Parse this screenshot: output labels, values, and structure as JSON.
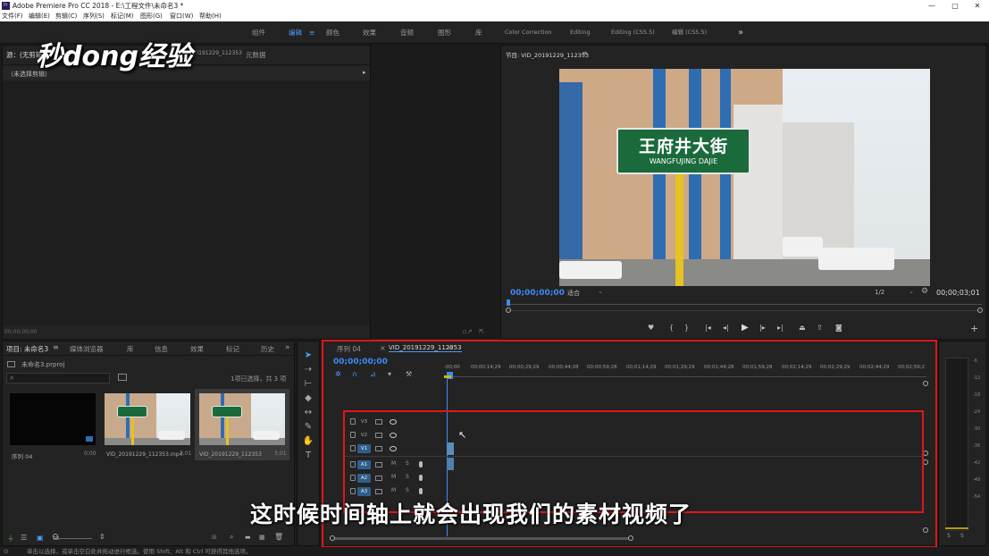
{
  "app": {
    "title": "Adobe Premiere Pro CC 2018 - E:\\工程文件\\未命名3 *",
    "logo": "Pr"
  },
  "window_controls": {
    "minimize": "—",
    "maximize": "▢",
    "close": "✕"
  },
  "menu": [
    "文件(F)",
    "编辑(E)",
    "剪辑(C)",
    "序列(S)",
    "标记(M)",
    "图形(G)",
    "窗口(W)",
    "帮助(H)"
  ],
  "workspaces": {
    "items": [
      "组件",
      "编辑",
      "颜色",
      "效果",
      "音频",
      "图形",
      "库",
      "Color Correction",
      "Editing",
      "Editing (CS5.5)",
      "编辑 (CS5.5)"
    ],
    "active_index": 1,
    "more": "»"
  },
  "source_panel": {
    "tabs": [
      "源：(无剪辑)",
      "VID_20191229_112353",
      "元数据"
    ],
    "dropdown": "（未选择剪辑）",
    "timecode": "00;00;00;00"
  },
  "program_panel": {
    "title": "节目: VID_20191229_112353",
    "timecode_left": "00;00;00;00",
    "fit": "适合",
    "resolution": "1/2",
    "timecode_right": "00;00;03;01",
    "sign_cn": "王府井大街",
    "sign_en": "WANGFUJING DAJIE"
  },
  "project_panel": {
    "tabs": [
      "项目: 未命名3",
      "媒体浏览器",
      "库",
      "信息",
      "效果",
      "标记",
      "历史"
    ],
    "file": "未命名3.prproj",
    "selection": "1项已选择，共 3 项",
    "items": [
      {
        "name": "序列 04",
        "duration": "0;00"
      },
      {
        "name": "VID_20191229_112353.mp4",
        "duration": "3;01"
      },
      {
        "name": "VID_20191229_112353",
        "duration": "3;01"
      }
    ]
  },
  "timeline": {
    "tabs": [
      "序列 04",
      "VID_20191229_112353"
    ],
    "timecode": "00;00;00;00",
    "ruler": [
      ":00;00",
      "00;00;14;29",
      "00;00;29;29",
      "00;00;44;28",
      "00;00;59;28",
      "00;01;14;29",
      "00;01;29;29",
      "00;01;44;28",
      "00;01;59;28",
      "00;02;14;29",
      "00;02;29;29",
      "00;02;44;29",
      "00;02;59;2"
    ],
    "video_tracks": [
      "V3",
      "V2",
      "V1"
    ],
    "audio_tracks": [
      "A1",
      "A2",
      "A3"
    ],
    "mute": "M",
    "solo": "S"
  },
  "meter": {
    "ticks": [
      "-6",
      "-12",
      "-18",
      "-24",
      "-30",
      "-36",
      "-42",
      "-48",
      "-54"
    ],
    "labels": [
      "S",
      "S"
    ]
  },
  "status": "单击以选择，或单击空白处并拖动进行框选。使用 Shift、Alt 和 Ctrl 可获得其他选项。",
  "overlay": {
    "watermark": "秒dong经验",
    "subtitle": "这时候时间轴上就会出现我们的素材视频了"
  },
  "colors": {
    "accent": "#4b9cff",
    "timecode": "#3a8cf5",
    "highlight_box": "#e01616"
  }
}
